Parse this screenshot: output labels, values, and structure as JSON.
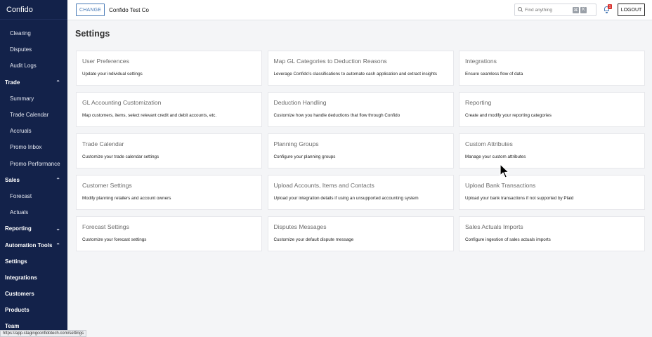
{
  "app": {
    "brand": "Confido"
  },
  "sidebar": {
    "items": [
      {
        "label": "Clearing",
        "level": "sub"
      },
      {
        "label": "Disputes",
        "level": "sub"
      },
      {
        "label": "Audit Logs",
        "level": "sub"
      },
      {
        "label": "Trade",
        "level": "top",
        "chevron": "chevron-up"
      },
      {
        "label": "Summary",
        "level": "sub"
      },
      {
        "label": "Trade Calendar",
        "level": "sub"
      },
      {
        "label": "Accruals",
        "level": "sub"
      },
      {
        "label": "Promo Inbox",
        "level": "sub"
      },
      {
        "label": "Promo Performance",
        "level": "sub"
      },
      {
        "label": "Sales",
        "level": "top",
        "chevron": "chevron-up"
      },
      {
        "label": "Forecast",
        "level": "sub"
      },
      {
        "label": "Actuals",
        "level": "sub"
      },
      {
        "label": "Reporting",
        "level": "top",
        "chevron": "chevron-down"
      },
      {
        "label": "Automation Tools",
        "level": "top",
        "chevron": "chevron-up"
      },
      {
        "label": "Settings",
        "level": "top"
      },
      {
        "label": "Integrations",
        "level": "top"
      },
      {
        "label": "Customers",
        "level": "top"
      },
      {
        "label": "Products",
        "level": "top"
      },
      {
        "label": "Team",
        "level": "top"
      }
    ]
  },
  "header": {
    "change_label": "CHANGE",
    "company": "Confido Test Co",
    "search_placeholder": "Find anything",
    "shortcut_keys": [
      "⌘",
      "K"
    ],
    "notification_count": "1",
    "logout_label": "LOGOUT"
  },
  "main": {
    "title": "Settings",
    "cards": [
      {
        "title": "User Preferences",
        "desc": "Update your individual settings"
      },
      {
        "title": "Map GL Categories to Deduction Reasons",
        "desc": "Leverage Confido's classifications to automate cash application and extract insights"
      },
      {
        "title": "Integrations",
        "desc": "Ensure seamless flow of data"
      },
      {
        "title": "GL Accounting Customization",
        "desc": "Map customers, items, select relevant credit and debit accounts, etc."
      },
      {
        "title": "Deduction Handling",
        "desc": "Customize how you handle deductions that flow through Confido"
      },
      {
        "title": "Reporting",
        "desc": "Create and modify your reporting categories"
      },
      {
        "title": "Trade Calendar",
        "desc": "Customize your trade calendar settings"
      },
      {
        "title": "Planning Groups",
        "desc": "Configure your planning groups"
      },
      {
        "title": "Custom Attributes",
        "desc": "Manage your custom attributes"
      },
      {
        "title": "Customer Settings",
        "desc": "Modify planning retailers and account owners"
      },
      {
        "title": "Upload Accounts, Items and Contacts",
        "desc": "Upload your integration details if using an unsupported accounting system"
      },
      {
        "title": "Upload Bank Transactions",
        "desc": "Upload your bank transactions if not supported by Plaid"
      },
      {
        "title": "Forecast Settings",
        "desc": "Customize your forecast settings"
      },
      {
        "title": "Disputes Messages",
        "desc": "Customize your default dispute message"
      },
      {
        "title": "Sales Actuals Imports",
        "desc": "Configure ingestion of sales actuals imports"
      }
    ]
  },
  "statusbar": {
    "url": "https://app.stagingconfidotech.com/settings"
  }
}
